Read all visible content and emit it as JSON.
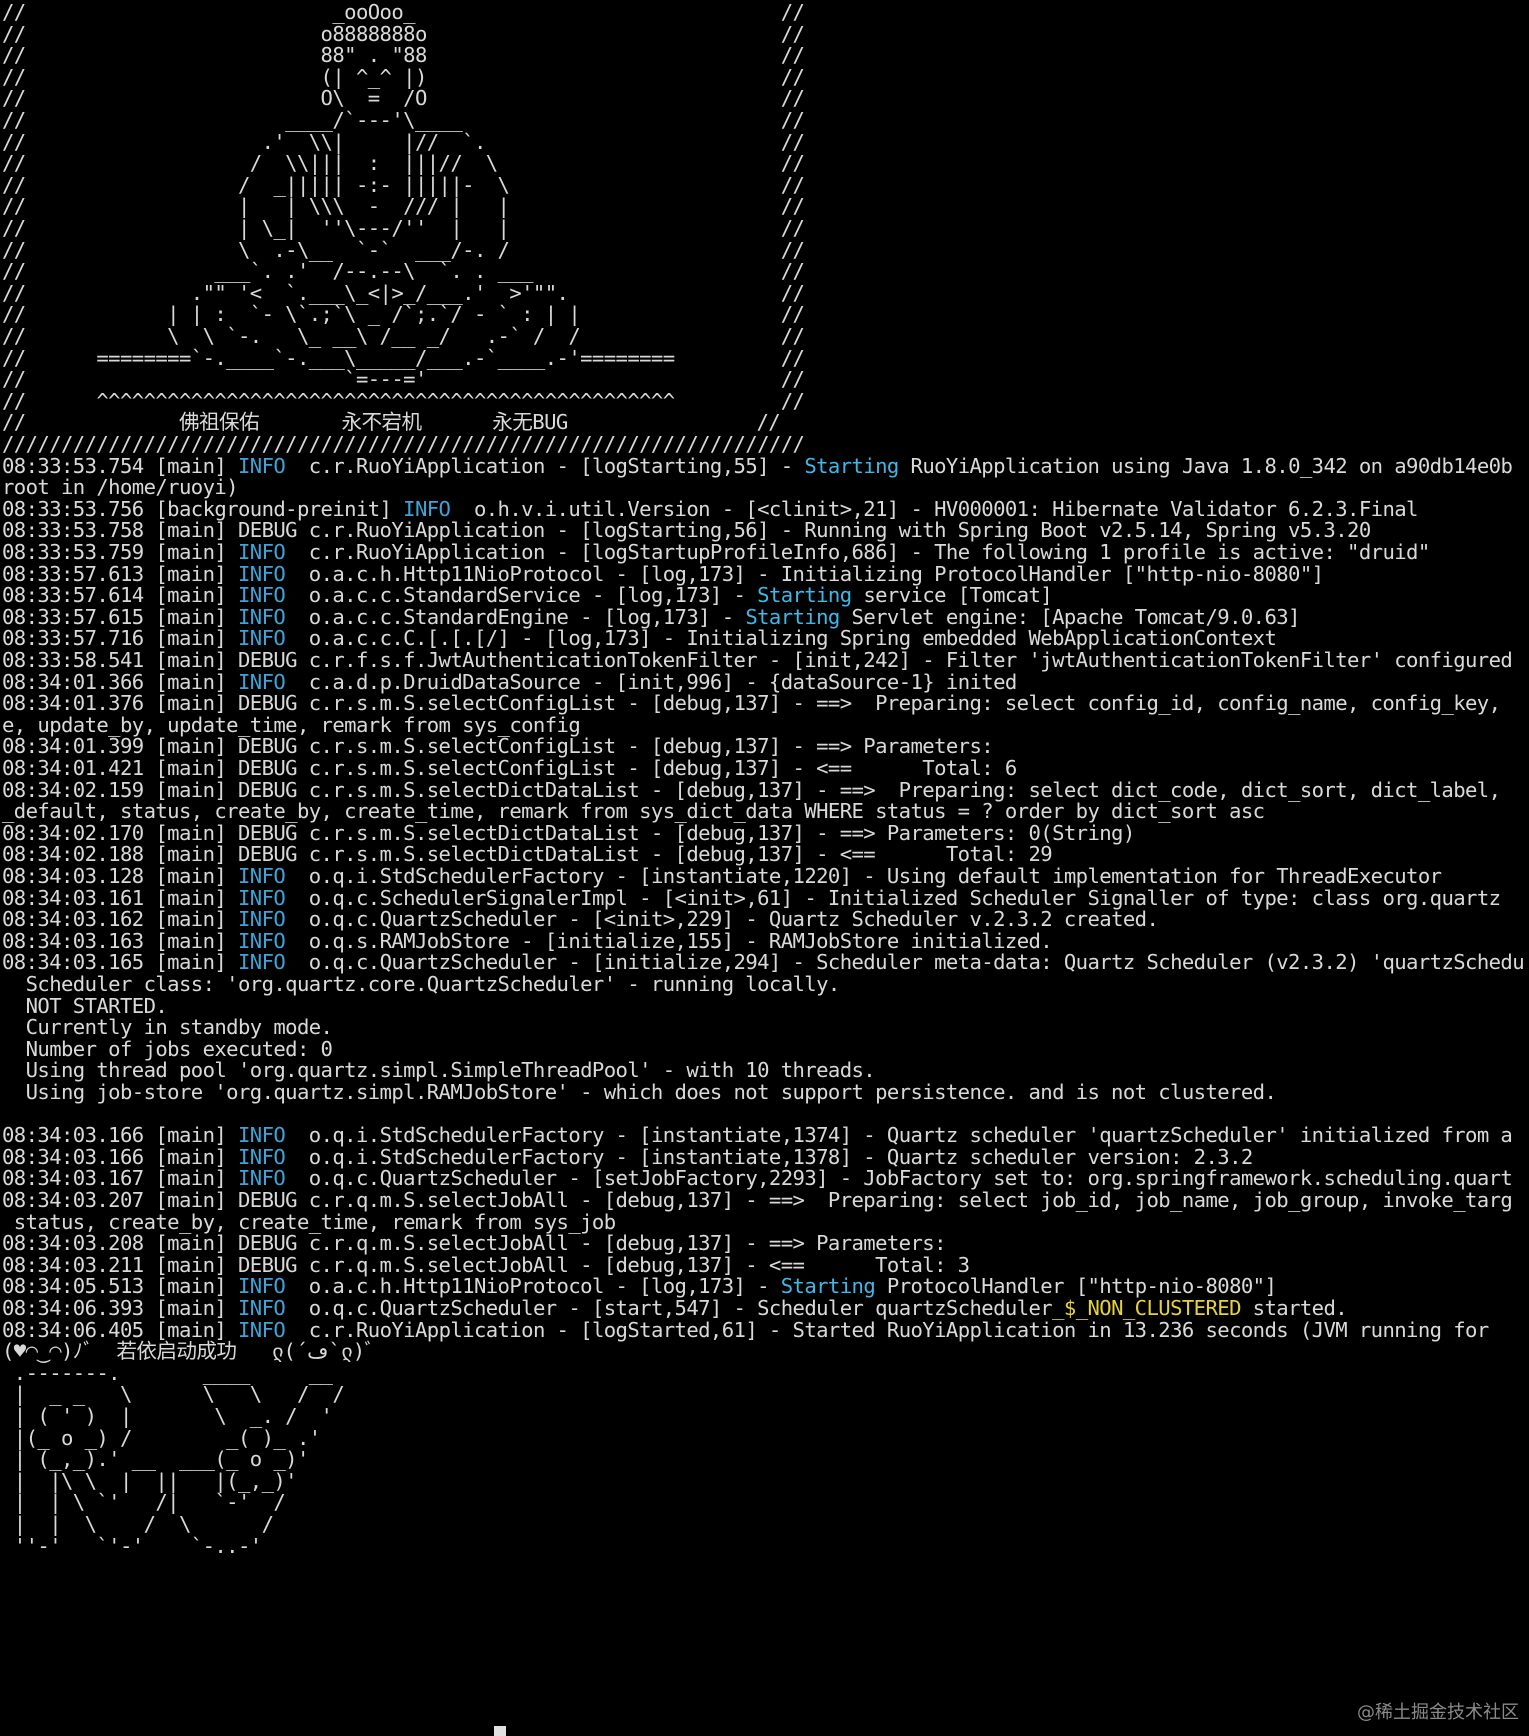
{
  "colors": {
    "background": "#000000",
    "text": "#d9d9d9",
    "info": "#3fa3d8",
    "starting": "#3fb8e8",
    "cluster": "#e6d23a"
  },
  "banner": [
    "//                          _ooOoo_                               //",
    "//                         o8888888o                              //",
    "//                         88\" . \"88                              //",
    "//                         (| ^_^ |)                              //",
    "//                         O\\  =  /O                              //",
    "//                      ____/`---'\\____                           //",
    "//                    .'  \\\\|     |//  `.                         //",
    "//                   /  \\\\|||  :  |||//  \\                        //",
    "//                  /  _||||| -:- |||||-  \\                       //",
    "//                  |   | \\\\\\  -  /// |   |                       //",
    "//                  | \\_|  ''\\---/''  |   |                       //",
    "//                  \\  .-\\__  `-`  ___/-. /                       //",
    "//                ___`. .'  /--.--\\  `. . ___                     //",
    "//              .\"\" '<  `.___\\_<|>_/___.'  >'\"\".                  //",
    "//            | | :  `- \\`.;`\\ _ /`;.`/ - ` : | |                 //",
    "//            \\  \\ `-.   \\_ __\\ /__ _/   .-` /  /                 //",
    "//      ========`-.____`-.___\\_____/___.-`____.-'========         //",
    "//                           `=---='                              //",
    "//      ^^^^^^^^^^^^^^^^^^^^^^^^^^^^^^^^^^^^^^^^^^^^^^^^^         //",
    "//             佛祖保佑       永不宕机      永无BUG                //",
    "////////////////////////////////////////////////////////////////////"
  ],
  "log": [
    {
      "pre": "08:33:53.754 [main] ",
      "level": "INFO ",
      "rest1": " c.r.RuoYiApplication - [logStarting,55] - ",
      "hl": "Starting",
      "rest2": " RuoYiApplication using Java 1.8.0_342 on a90db14e0b"
    },
    {
      "plain": "root in /home/ruoyi)"
    },
    {
      "pre": "08:33:53.756 [background-preinit] ",
      "level": "INFO ",
      "rest1": " o.h.v.i.util.Version - [<clinit>,21] - HV000001: Hibernate Validator 6.2.3.Final"
    },
    {
      "plain": "08:33:53.758 [main] DEBUG c.r.RuoYiApplication - [logStarting,56] - Running with Spring Boot v2.5.14, Spring v5.3.20"
    },
    {
      "pre": "08:33:53.759 [main] ",
      "level": "INFO ",
      "rest1": " c.r.RuoYiApplication - [logStartupProfileInfo,686] - The following 1 profile is active: \"druid\""
    },
    {
      "pre": "08:33:57.613 [main] ",
      "level": "INFO ",
      "rest1": " o.a.c.h.Http11NioProtocol - [log,173] - Initializing ProtocolHandler [\"http-nio-8080\"]"
    },
    {
      "pre": "08:33:57.614 [main] ",
      "level": "INFO ",
      "rest1": " o.a.c.c.StandardService - [log,173] - ",
      "hl": "Starting",
      "rest2": " service [Tomcat]"
    },
    {
      "pre": "08:33:57.615 [main] ",
      "level": "INFO ",
      "rest1": " o.a.c.c.StandardEngine - [log,173] - ",
      "hl": "Starting",
      "rest2": " Servlet engine: [Apache Tomcat/9.0.63]"
    },
    {
      "pre": "08:33:57.716 [main] ",
      "level": "INFO ",
      "rest1": " o.a.c.c.C.[.[.[/] - [log,173] - Initializing Spring embedded WebApplicationContext"
    },
    {
      "plain": "08:33:58.541 [main] DEBUG c.r.f.s.f.JwtAuthenticationTokenFilter - [init,242] - Filter 'jwtAuthenticationTokenFilter' configured"
    },
    {
      "pre": "08:34:01.366 [main] ",
      "level": "INFO ",
      "rest1": " c.a.d.p.DruidDataSource - [init,996] - {dataSource-1} inited"
    },
    {
      "plain": "08:34:01.376 [main] DEBUG c.r.s.m.S.selectConfigList - [debug,137] - ==>  Preparing: select config_id, config_name, config_key,"
    },
    {
      "plain": "e, update_by, update_time, remark from sys_config"
    },
    {
      "plain": "08:34:01.399 [main] DEBUG c.r.s.m.S.selectConfigList - [debug,137] - ==> Parameters: "
    },
    {
      "plain": "08:34:01.421 [main] DEBUG c.r.s.m.S.selectConfigList - [debug,137] - <==      Total: 6"
    },
    {
      "plain": "08:34:02.159 [main] DEBUG c.r.s.m.S.selectDictDataList - [debug,137] - ==>  Preparing: select dict_code, dict_sort, dict_label,"
    },
    {
      "plain": "_default, status, create_by, create_time, remark from sys_dict_data WHERE status = ? order by dict_sort asc"
    },
    {
      "plain": "08:34:02.170 [main] DEBUG c.r.s.m.S.selectDictDataList - [debug,137] - ==> Parameters: 0(String)"
    },
    {
      "plain": "08:34:02.188 [main] DEBUG c.r.s.m.S.selectDictDataList - [debug,137] - <==      Total: 29"
    },
    {
      "pre": "08:34:03.128 [main] ",
      "level": "INFO ",
      "rest1": " o.q.i.StdSchedulerFactory - [instantiate,1220] - Using default implementation for ThreadExecutor"
    },
    {
      "pre": "08:34:03.161 [main] ",
      "level": "INFO ",
      "rest1": " o.q.c.SchedulerSignalerImpl - [<init>,61] - Initialized Scheduler Signaller of type: class org.quartz"
    },
    {
      "pre": "08:34:03.162 [main] ",
      "level": "INFO ",
      "rest1": " o.q.c.QuartzScheduler - [<init>,229] - Quartz Scheduler v.2.3.2 created."
    },
    {
      "pre": "08:34:03.163 [main] ",
      "level": "INFO ",
      "rest1": " o.q.s.RAMJobStore - [initialize,155] - RAMJobStore initialized."
    },
    {
      "pre": "08:34:03.165 [main] ",
      "level": "INFO ",
      "rest1": " o.q.c.QuartzScheduler - [initialize,294] - Scheduler meta-data: Quartz Scheduler (v2.3.2) 'quartzSchedu"
    },
    {
      "plain": "  Scheduler class: 'org.quartz.core.QuartzScheduler' - running locally."
    },
    {
      "plain": "  NOT STARTED."
    },
    {
      "plain": "  Currently in standby mode."
    },
    {
      "plain": "  Number of jobs executed: 0"
    },
    {
      "plain": "  Using thread pool 'org.quartz.simpl.SimpleThreadPool' - with 10 threads."
    },
    {
      "plain": "  Using job-store 'org.quartz.simpl.RAMJobStore' - which does not support persistence. and is not clustered."
    },
    {
      "plain": ""
    },
    {
      "pre": "08:34:03.166 [main] ",
      "level": "INFO ",
      "rest1": " o.q.i.StdSchedulerFactory - [instantiate,1374] - Quartz scheduler 'quartzScheduler' initialized from a"
    },
    {
      "pre": "08:34:03.166 [main] ",
      "level": "INFO ",
      "rest1": " o.q.i.StdSchedulerFactory - [instantiate,1378] - Quartz scheduler version: 2.3.2"
    },
    {
      "pre": "08:34:03.167 [main] ",
      "level": "INFO ",
      "rest1": " o.q.c.QuartzScheduler - [setJobFactory,2293] - JobFactory set to: org.springframework.scheduling.quart"
    },
    {
      "plain": "08:34:03.207 [main] DEBUG c.r.q.m.S.selectJobAll - [debug,137] - ==>  Preparing: select job_id, job_name, job_group, invoke_targ"
    },
    {
      "plain": " status, create_by, create_time, remark from sys_job"
    },
    {
      "plain": "08:34:03.208 [main] DEBUG c.r.q.m.S.selectJobAll - [debug,137] - ==> Parameters: "
    },
    {
      "plain": "08:34:03.211 [main] DEBUG c.r.q.m.S.selectJobAll - [debug,137] - <==      Total: 3"
    },
    {
      "pre": "08:34:05.513 [main] ",
      "level": "INFO ",
      "rest1": " o.a.c.h.Http11NioProtocol - [log,173] - ",
      "hl": "Starting",
      "rest2": " ProtocolHandler [\"http-nio-8080\"]"
    },
    {
      "pre": "08:34:06.393 [main] ",
      "level": "INFO ",
      "rest1": " o.q.c.QuartzScheduler - [start,547] - Scheduler quartzScheduler",
      "yel": "_$_NON_CLUSTERED",
      "rest2": " started."
    },
    {
      "pre": "08:34:06.405 [main] ",
      "level": "INFO ",
      "rest1": " c.r.RuoYiApplication - [logStarted,61] - Started RuoYiApplication in 13.236 seconds (JVM running for"
    }
  ],
  "success_line": "(♥◠‿◠)ﾉﾞ  若依启动成功   ლ(´ڡ`ლ)ﾞ",
  "logo": [
    " .-------.       ____     __        ",
    " |  _ _   \\      \\   \\   /  /    ",
    " | ( ' )  |       \\  _. /  '       ",
    " |(_ o _) /        _( )_ .'         ",
    " | (_,_).' __  ___(_ o _)'          ",
    " |  |\\ \\  |  ||   |(_,_)'         ",
    " |  | \\ `'   /|   `-'  /           ",
    " |  |  \\    /  \\      /           ",
    " ''-'   `'-'    `-..-'              "
  ],
  "watermark": "@稀土掘金技术社区"
}
